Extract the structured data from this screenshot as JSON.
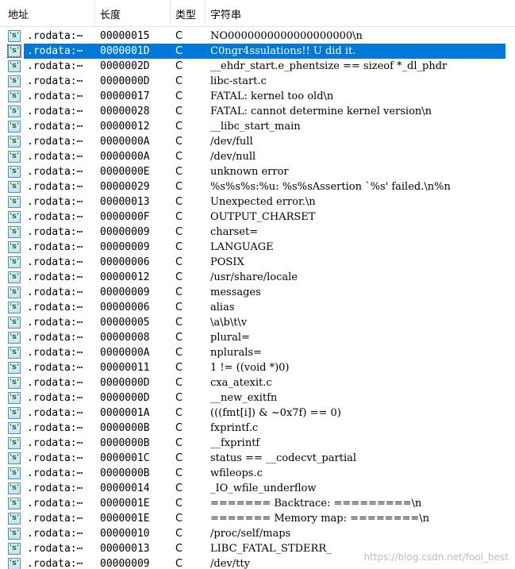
{
  "columns": {
    "address": "地址",
    "length": "长度",
    "type": "类型",
    "string": "字符串"
  },
  "colors": {
    "selection": "#0078d7",
    "icon_text": "#1b7a24"
  },
  "row_icon": "string-s-icon",
  "selected_index": 1,
  "rows": [
    {
      "icon": "'s'",
      "segment": ".rodata:⋯",
      "length": "00000015",
      "type": "C",
      "value": "NO0000000000000000000\\n"
    },
    {
      "icon": "'s'",
      "segment": ".rodata:⋯",
      "length": "0000001D",
      "type": "C",
      "value": "C0ngr4ssulations!! U did it."
    },
    {
      "icon": "'s'",
      "segment": ".rodata:⋯",
      "length": "0000002D",
      "type": "C",
      "value": "__ehdr_start.e_phentsize == sizeof *_dl_phdr"
    },
    {
      "icon": "'s'",
      "segment": ".rodata:⋯",
      "length": "0000000D",
      "type": "C",
      "value": "libc-start.c"
    },
    {
      "icon": "'s'",
      "segment": ".rodata:⋯",
      "length": "00000017",
      "type": "C",
      "value": "FATAL: kernel too old\\n"
    },
    {
      "icon": "'s'",
      "segment": ".rodata:⋯",
      "length": "00000028",
      "type": "C",
      "value": "FATAL: cannot determine kernel version\\n"
    },
    {
      "icon": "'s'",
      "segment": ".rodata:⋯",
      "length": "00000012",
      "type": "C",
      "value": "__libc_start_main"
    },
    {
      "icon": "'s'",
      "segment": ".rodata:⋯",
      "length": "0000000A",
      "type": "C",
      "value": "/dev/full"
    },
    {
      "icon": "'s'",
      "segment": ".rodata:⋯",
      "length": "0000000A",
      "type": "C",
      "value": "/dev/null"
    },
    {
      "icon": "'s'",
      "segment": ".rodata:⋯",
      "length": "0000000E",
      "type": "C",
      "value": "unknown error"
    },
    {
      "icon": "'s'",
      "segment": ".rodata:⋯",
      "length": "00000029",
      "type": "C",
      "value": "%s%s%s:%u: %s%sAssertion `%s' failed.\\n%n"
    },
    {
      "icon": "'s'",
      "segment": ".rodata:⋯",
      "length": "00000013",
      "type": "C",
      "value": "Unexpected error.\\n"
    },
    {
      "icon": "'s'",
      "segment": ".rodata:⋯",
      "length": "0000000F",
      "type": "C",
      "value": "OUTPUT_CHARSET"
    },
    {
      "icon": "'s'",
      "segment": ".rodata:⋯",
      "length": "00000009",
      "type": "C",
      "value": "charset="
    },
    {
      "icon": "'s'",
      "segment": ".rodata:⋯",
      "length": "00000009",
      "type": "C",
      "value": "LANGUAGE"
    },
    {
      "icon": "'s'",
      "segment": ".rodata:⋯",
      "length": "00000006",
      "type": "C",
      "value": "POSIX"
    },
    {
      "icon": "'s'",
      "segment": ".rodata:⋯",
      "length": "00000012",
      "type": "C",
      "value": "/usr/share/locale"
    },
    {
      "icon": "'s'",
      "segment": ".rodata:⋯",
      "length": "00000009",
      "type": "C",
      "value": "messages"
    },
    {
      "icon": "'s'",
      "segment": ".rodata:⋯",
      "length": "00000006",
      "type": "C",
      "value": "alias"
    },
    {
      "icon": "'s'",
      "segment": ".rodata:⋯",
      "length": "00000005",
      "type": "C",
      "value": "\\a\\b\\t\\v"
    },
    {
      "icon": "'s'",
      "segment": ".rodata:⋯",
      "length": "00000008",
      "type": "C",
      "value": "plural="
    },
    {
      "icon": "'s'",
      "segment": ".rodata:⋯",
      "length": "0000000A",
      "type": "C",
      "value": "nplurals="
    },
    {
      "icon": "'s'",
      "segment": ".rodata:⋯",
      "length": "00000011",
      "type": "C",
      "value": "1 != ((void *)0)"
    },
    {
      "icon": "'s'",
      "segment": ".rodata:⋯",
      "length": "0000000D",
      "type": "C",
      "value": "cxa_atexit.c"
    },
    {
      "icon": "'s'",
      "segment": ".rodata:⋯",
      "length": "0000000D",
      "type": "C",
      "value": "__new_exitfn"
    },
    {
      "icon": "'s'",
      "segment": ".rodata:⋯",
      "length": "0000001A",
      "type": "C",
      "value": "(((fmt[i]) & ~0x7f) == 0)"
    },
    {
      "icon": "'s'",
      "segment": ".rodata:⋯",
      "length": "0000000B",
      "type": "C",
      "value": "fxprintf.c"
    },
    {
      "icon": "'s'",
      "segment": ".rodata:⋯",
      "length": "0000000B",
      "type": "C",
      "value": "__fxprintf"
    },
    {
      "icon": "'s'",
      "segment": ".rodata:⋯",
      "length": "0000001C",
      "type": "C",
      "value": "status == __codecvt_partial"
    },
    {
      "icon": "'s'",
      "segment": ".rodata:⋯",
      "length": "0000000B",
      "type": "C",
      "value": "wfileops.c"
    },
    {
      "icon": "'s'",
      "segment": ".rodata:⋯",
      "length": "00000014",
      "type": "C",
      "value": "_IO_wfile_underflow"
    },
    {
      "icon": "'s'",
      "segment": ".rodata:⋯",
      "length": "0000001E",
      "type": "C",
      "value": "======= Backtrace: =========\\n"
    },
    {
      "icon": "'s'",
      "segment": ".rodata:⋯",
      "length": "0000001E",
      "type": "C",
      "value": "======= Memory map: ========\\n"
    },
    {
      "icon": "'s'",
      "segment": ".rodata:⋯",
      "length": "00000010",
      "type": "C",
      "value": "/proc/self/maps"
    },
    {
      "icon": "'s'",
      "segment": ".rodata:⋯",
      "length": "00000013",
      "type": "C",
      "value": "LIBC_FATAL_STDERR_"
    },
    {
      "icon": "'s'",
      "segment": ".rodata:⋯",
      "length": "00000009",
      "type": "C",
      "value": "/dev/tty"
    }
  ],
  "watermark": "https://blog.csdn.net/fool_best"
}
